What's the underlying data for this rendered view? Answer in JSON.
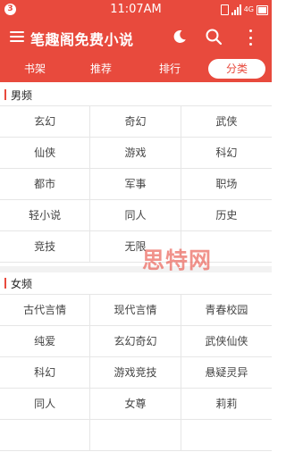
{
  "status_bar": {
    "notification_count": "3",
    "time": "11:07AM",
    "network": "4G"
  },
  "app_bar": {
    "title": "笔趣阁免费小说",
    "icons": [
      "menu-icon",
      "moon-icon",
      "search-icon",
      "more-vertical-icon"
    ]
  },
  "tabs": [
    {
      "label": "书架",
      "active": false
    },
    {
      "label": "推荐",
      "active": false
    },
    {
      "label": "排行",
      "active": false
    },
    {
      "label": "分类",
      "active": true
    }
  ],
  "male_section": {
    "label": "男频",
    "categories": [
      "玄幻",
      "奇幻",
      "武侠",
      "仙侠",
      "游戏",
      "科幻",
      "都市",
      "军事",
      "职场",
      "轻小说",
      "同人",
      "历史",
      "竞技",
      "无限"
    ]
  },
  "female_section": {
    "label": "女频",
    "categories": [
      "古代言情",
      "现代言情",
      "青春校园",
      "纯爱",
      "玄幻奇幻",
      "武侠仙侠",
      "科幻",
      "游戏竞技",
      "悬疑灵异",
      "同人",
      "女尊",
      "莉莉"
    ]
  },
  "watermark": "思特网",
  "colors": {
    "accent": "#e84a3d",
    "divider": "#e6e6e6",
    "background": "#ffffff"
  }
}
